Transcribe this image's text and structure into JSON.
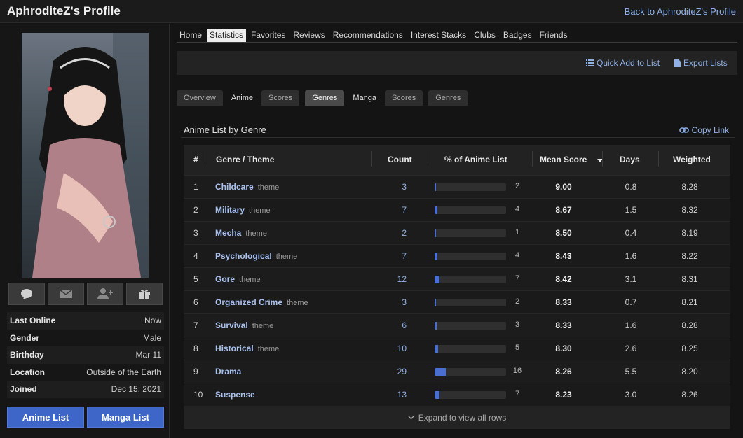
{
  "header": {
    "title": "AphroditeZ's Profile",
    "back_link": "Back to AphroditeZ's Profile"
  },
  "sidebar": {
    "avatar_icons": [
      "speech-bubble-icon",
      "envelope-icon",
      "add-friend-icon",
      "gift-icon"
    ],
    "info": [
      {
        "label": "Last Online",
        "value": "Now"
      },
      {
        "label": "Gender",
        "value": "Male"
      },
      {
        "label": "Birthday",
        "value": "Mar 11"
      },
      {
        "label": "Location",
        "value": "Outside of the Earth"
      },
      {
        "label": "Joined",
        "value": "Dec 15, 2021"
      }
    ],
    "anime_list_label": "Anime List",
    "manga_list_label": "Manga List"
  },
  "nav": {
    "items": [
      "Home",
      "Statistics",
      "Favorites",
      "Reviews",
      "Recommendations",
      "Interest Stacks",
      "Clubs",
      "Badges",
      "Friends"
    ],
    "active": "Statistics"
  },
  "toolbar": {
    "quick_add": "Quick Add to List",
    "export": "Export Lists"
  },
  "subtabs": {
    "overview": "Overview",
    "anime": "Anime",
    "anime_scores": "Scores",
    "anime_genres": "Genres",
    "manga": "Manga",
    "manga_scores": "Scores",
    "manga_genres": "Genres",
    "active": "anime_genres"
  },
  "section": {
    "title": "Anime List by Genre",
    "copy_link": "Copy Link"
  },
  "table": {
    "headers": {
      "rank": "#",
      "genre": "Genre / Theme",
      "count": "Count",
      "percent": "% of Anime List",
      "mean": "Mean Score",
      "days": "Days",
      "weighted": "Weighted"
    },
    "sort_indicator": "caret-down-icon",
    "rows": [
      {
        "rank": "1",
        "genre": "Childcare",
        "kind": "theme",
        "count": "3",
        "percent": 2,
        "mean": "9.00",
        "days": "0.8",
        "weighted": "8.28"
      },
      {
        "rank": "2",
        "genre": "Military",
        "kind": "theme",
        "count": "7",
        "percent": 4,
        "mean": "8.67",
        "days": "1.5",
        "weighted": "8.32"
      },
      {
        "rank": "3",
        "genre": "Mecha",
        "kind": "theme",
        "count": "2",
        "percent": 1,
        "mean": "8.50",
        "days": "0.4",
        "weighted": "8.19"
      },
      {
        "rank": "4",
        "genre": "Psychological",
        "kind": "theme",
        "count": "7",
        "percent": 4,
        "mean": "8.43",
        "days": "1.6",
        "weighted": "8.22"
      },
      {
        "rank": "5",
        "genre": "Gore",
        "kind": "theme",
        "count": "12",
        "percent": 7,
        "mean": "8.42",
        "days": "3.1",
        "weighted": "8.31"
      },
      {
        "rank": "6",
        "genre": "Organized Crime",
        "kind": "theme",
        "count": "3",
        "percent": 2,
        "mean": "8.33",
        "days": "0.7",
        "weighted": "8.21"
      },
      {
        "rank": "7",
        "genre": "Survival",
        "kind": "theme",
        "count": "6",
        "percent": 3,
        "mean": "8.33",
        "days": "1.6",
        "weighted": "8.28"
      },
      {
        "rank": "8",
        "genre": "Historical",
        "kind": "theme",
        "count": "10",
        "percent": 5,
        "mean": "8.30",
        "days": "2.6",
        "weighted": "8.25"
      },
      {
        "rank": "9",
        "genre": "Drama",
        "kind": "",
        "count": "29",
        "percent": 16,
        "mean": "8.26",
        "days": "5.5",
        "weighted": "8.20"
      },
      {
        "rank": "10",
        "genre": "Suspense",
        "kind": "",
        "count": "13",
        "percent": 7,
        "mean": "8.23",
        "days": "3.0",
        "weighted": "8.26"
      }
    ],
    "expand_label": "Expand to view all rows"
  },
  "colors": {
    "accent_blue": "#3e65c8",
    "link_blue": "#8fb1e8",
    "bar_fill": "#4a6fd0"
  }
}
